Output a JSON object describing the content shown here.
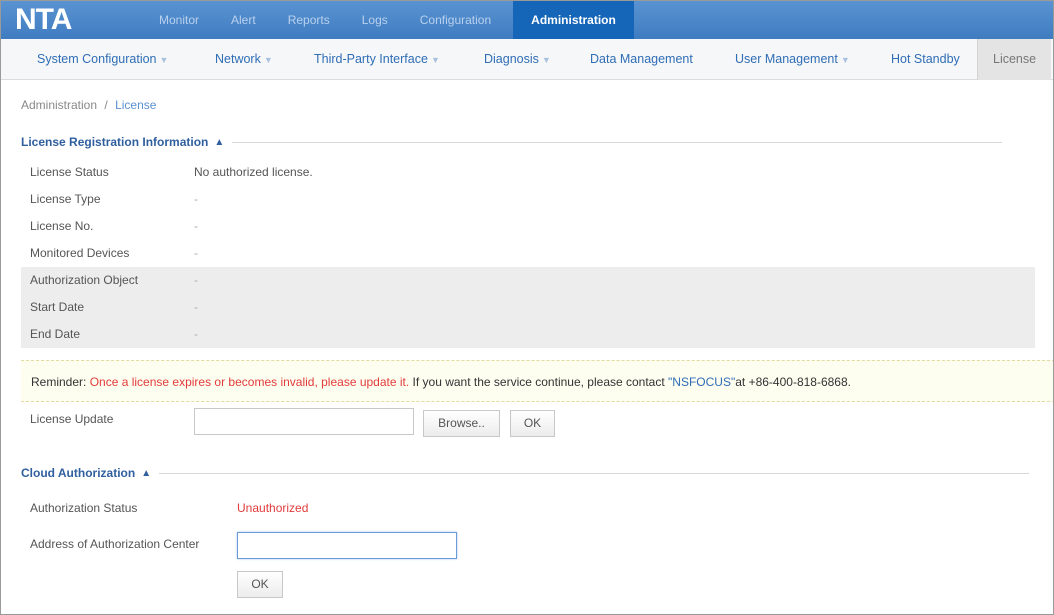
{
  "app": {
    "logo": "NTA"
  },
  "top_nav": {
    "tabs": [
      {
        "label": "Monitor"
      },
      {
        "label": "Alert"
      },
      {
        "label": "Reports"
      },
      {
        "label": "Logs"
      },
      {
        "label": "Configuration"
      },
      {
        "label": "Administration",
        "active": true
      }
    ]
  },
  "sub_nav": {
    "items": [
      {
        "label": "System Configuration",
        "dropdown": true
      },
      {
        "label": "Network",
        "dropdown": true
      },
      {
        "label": "Third-Party Interface",
        "dropdown": true
      },
      {
        "label": "Diagnosis",
        "dropdown": true
      },
      {
        "label": "Data Management",
        "dropdown": false
      },
      {
        "label": "User Management",
        "dropdown": true
      },
      {
        "label": "Hot Standby",
        "dropdown": false
      },
      {
        "label": "License",
        "dropdown": false,
        "active": true
      }
    ],
    "caret": "▼"
  },
  "breadcrumb": {
    "parent": "Administration",
    "separator": "/",
    "current": "License"
  },
  "license_section": {
    "title": "License Registration Information",
    "collapse_icon": "chevron-up-icon",
    "rows": [
      {
        "label": "License Status",
        "value": "No authorized license."
      },
      {
        "label": "License Type",
        "value": "-"
      },
      {
        "label": "License No.",
        "value": "-"
      },
      {
        "label": "Monitored Devices",
        "value": "-"
      },
      {
        "label": "Authorization Object",
        "value": "-"
      },
      {
        "label": "Start Date",
        "value": "-"
      },
      {
        "label": "End Date",
        "value": "-"
      }
    ]
  },
  "reminder": {
    "prefix": "Reminder: ",
    "warning": "Once a license expires or becomes invalid, please update it.",
    "middle": " If you want the service continue, please contact ",
    "company": "\"NSFOCUS\"",
    "suffix": "at +86-400-818-6868."
  },
  "license_update": {
    "label": "License Update",
    "file_value": "",
    "browse_label": "Browse..",
    "ok_label": "OK"
  },
  "cloud_section": {
    "title": "Cloud Authorization",
    "collapse_icon": "chevron-up-icon",
    "status_label": "Authorization Status",
    "status_value": "Unauthorized",
    "address_label": "Address of Authorization Center",
    "address_value": "",
    "ok_label": "OK"
  },
  "colors": {
    "top_bar": "#3f7cc0",
    "active_tab": "#1565b8",
    "link": "#2f6db5",
    "warning": "#e23b3b",
    "section_title": "#2f5f9e"
  }
}
